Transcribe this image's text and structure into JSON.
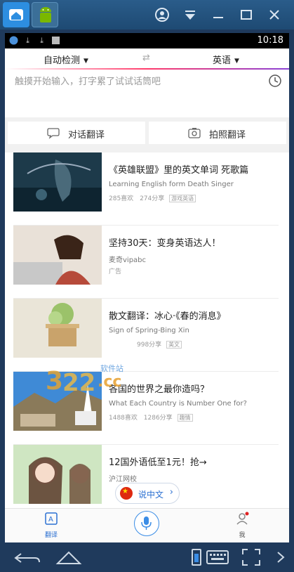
{
  "emulator": {
    "tabs": [
      "home-tab",
      "android-tab"
    ],
    "controls": [
      "user-icon",
      "menu-down-icon",
      "minimize-icon",
      "maximize-icon",
      "close-icon"
    ]
  },
  "status_bar": {
    "time": "10:18"
  },
  "language_bar": {
    "source": "自动检测",
    "target": "英语"
  },
  "input": {
    "placeholder": "触摸开始输入，打字累了试试话筒吧"
  },
  "actions": {
    "dialog": "对话翻译",
    "photo": "拍照翻译"
  },
  "feed": [
    {
      "title": "《英雄联盟》里的英文单词 死歌篇",
      "subtitle": "Learning English form Death Singer",
      "likes": "285喜欢",
      "shares": "274分享",
      "tag": "游戏英语"
    },
    {
      "title": "坚持30天：变身英语达人！",
      "subtitle": "麦奇vipabc",
      "meta": "广告"
    },
    {
      "title": "散文翻译：冰心·《春的消息》",
      "subtitle": "Sign of Spring-Bing Xin",
      "likes": "",
      "shares": "998分享",
      "tag": "美文"
    },
    {
      "title": "各国的世界之最你造吗？",
      "subtitle": "What Each Country is Number One for?",
      "likes": "1488喜欢",
      "shares": "1286分享",
      "tag": "趣情"
    },
    {
      "title": "12国外语低至1元！抢→",
      "subtitle": "沪江网校"
    }
  ],
  "speak_chinese": {
    "label": "说中文",
    "flag_glyph": "★"
  },
  "bottom_nav": {
    "translate": "翻译",
    "me": "我"
  },
  "watermark": {
    "text": "322.cc",
    "sub": "软件站"
  },
  "colors": {
    "accent": "#2a6fd1",
    "emulator": "#1f3a5c",
    "line_start": "#ff3b6b",
    "line_end": "#8b42d6"
  }
}
